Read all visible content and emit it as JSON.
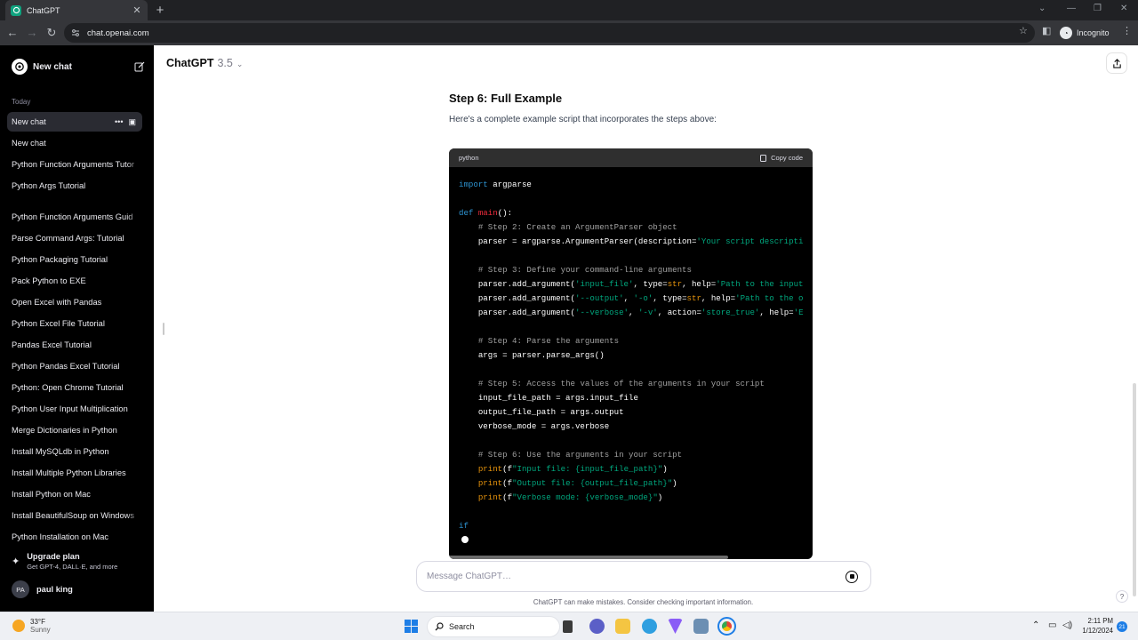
{
  "browser": {
    "tab_title": "ChatGPT",
    "url": "chat.openai.com",
    "profile_label": "Incognito"
  },
  "sidebar": {
    "new_chat_label": "New chat",
    "section_label": "Today",
    "active_item": {
      "label": "New chat"
    },
    "items": [
      "New chat",
      "Python Function Arguments Tutor",
      "Python Args Tutorial",
      "Python Function Arguments Guid",
      "Parse Command Args: Tutorial",
      "Python Packaging Tutorial",
      "Pack Python to EXE",
      "Open Excel with Pandas",
      "Python Excel File Tutorial",
      "Pandas Excel Tutorial",
      "Python Pandas Excel Tutorial",
      "Python: Open Chrome Tutorial",
      "Python User Input Multiplication",
      "Merge Dictionaries in Python",
      "Install MySQLdb in Python",
      "Install Multiple Python Libraries",
      "Install Python on Mac",
      "Install BeautifulSoup on Windows",
      "Python Installation on Mac"
    ],
    "upgrade": {
      "title": "Upgrade plan",
      "subtitle": "Get GPT-4, DALL·E, and more"
    },
    "user": {
      "initials": "PA",
      "name": "paul king"
    }
  },
  "header": {
    "model_name": "ChatGPT",
    "model_version": "3.5"
  },
  "message": {
    "heading": "Step 6: Full Example",
    "intro": "Here's a complete example script that incorporates the steps above:",
    "code_language": "python",
    "copy_label": "Copy code",
    "code_lines": [
      "import argparse",
      "",
      "def main():",
      "    # Step 2: Create an ArgumentParser object",
      "    parser = argparse.ArgumentParser(description='Your script descripti",
      "",
      "    # Step 3: Define your command-line arguments",
      "    parser.add_argument('input_file', type=str, help='Path to the input",
      "    parser.add_argument('--output', '-o', type=str, help='Path to the o",
      "    parser.add_argument('--verbose', '-v', action='store_true', help='E",
      "",
      "    # Step 4: Parse the arguments",
      "    args = parser.parse_args()",
      "",
      "    # Step 5: Access the values of the arguments in your script",
      "    input_file_path = args.input_file",
      "    output_file_path = args.output",
      "    verbose_mode = args.verbose",
      "",
      "    # Step 6: Use the arguments in your script",
      "    print(f\"Input file: {input_file_path}\")",
      "    print(f\"Output file: {output_file_path}\")",
      "    print(f\"Verbose mode: {verbose_mode}\")",
      "",
      "if"
    ]
  },
  "composer": {
    "placeholder": "Message ChatGPT…",
    "disclaimer": "ChatGPT can make mistakes. Consider checking important information.",
    "help_label": "?"
  },
  "taskbar": {
    "temperature": "33°F",
    "condition": "Sunny",
    "search_label": "Search",
    "time": "2:11 PM",
    "date": "1/12/2024",
    "notification_count": "21"
  },
  "colors": {
    "sidebar_bg": "#000000",
    "accent": "#10a37f",
    "code_keyword": "#2e95d3",
    "code_function": "#f22c3d",
    "code_string": "#00a67d",
    "code_comment": "#a0a0a0",
    "code_builtin": "#e9950c"
  },
  "icons": [
    "openai-logo-icon",
    "edit-icon",
    "share-icon",
    "copy-icon",
    "stop-icon",
    "search-icon",
    "windows-icon",
    "lock-icon"
  ]
}
